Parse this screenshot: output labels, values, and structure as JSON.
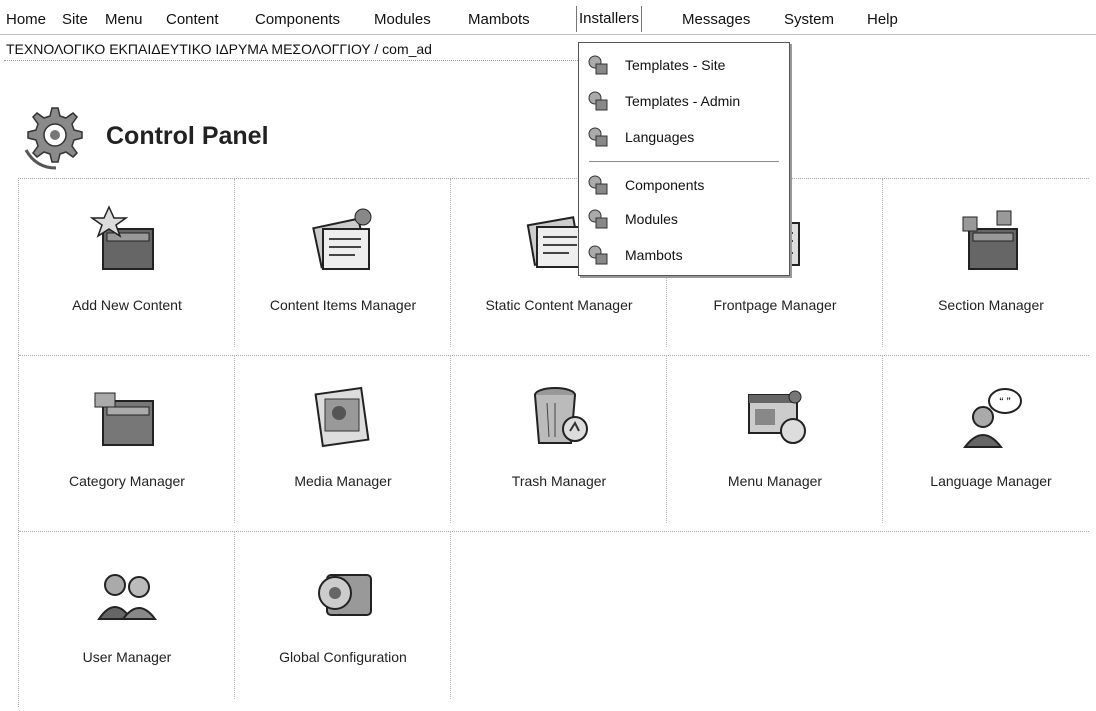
{
  "menu": {
    "items": [
      {
        "label": "Home",
        "active": false
      },
      {
        "label": "Site",
        "active": false
      },
      {
        "label": "Menu",
        "active": false
      },
      {
        "label": "Content",
        "active": false
      },
      {
        "label": "Components",
        "active": false
      },
      {
        "label": "Modules",
        "active": false
      },
      {
        "label": "Mambots",
        "active": false
      },
      {
        "label": "Installers",
        "active": true
      },
      {
        "label": "Messages",
        "active": false
      },
      {
        "label": "System",
        "active": false
      },
      {
        "label": "Help",
        "active": false
      }
    ]
  },
  "breadcrumb": "ΤΕΧΝΟΛΟΓΙΚΟ ΕΚΠΑΙΔΕΥΤΙΚΟ ΙΔΡΥΜΑ ΜΕΣΟΛΟΓΓΙΟΥ / com_ad",
  "page": {
    "title": "Control Panel",
    "title_icon": "gear-icon"
  },
  "dropdown": {
    "items": [
      {
        "label": "Templates - Site",
        "icon": "installer-icon"
      },
      {
        "label": "Templates - Admin",
        "icon": "installer-icon"
      },
      {
        "label": "Languages",
        "icon": "installer-icon"
      },
      {
        "label": "Components",
        "icon": "installer-icon"
      },
      {
        "label": "Modules",
        "icon": "installer-icon"
      },
      {
        "label": "Mambots",
        "icon": "installer-icon"
      }
    ]
  },
  "panel": {
    "items": [
      {
        "label": "Add New Content",
        "icon": "add-content-icon"
      },
      {
        "label": "Content Items Manager",
        "icon": "content-items-icon"
      },
      {
        "label": "Static Content Manager",
        "icon": "static-content-icon"
      },
      {
        "label": "Frontpage Manager",
        "icon": "frontpage-icon"
      },
      {
        "label": "Section Manager",
        "icon": "section-icon"
      },
      {
        "label": "Category Manager",
        "icon": "category-icon"
      },
      {
        "label": "Media Manager",
        "icon": "media-icon"
      },
      {
        "label": "Trash Manager",
        "icon": "trash-icon"
      },
      {
        "label": "Menu Manager",
        "icon": "menu-icon"
      },
      {
        "label": "Language Manager",
        "icon": "language-icon"
      },
      {
        "label": "User Manager",
        "icon": "users-icon"
      },
      {
        "label": "Global Configuration",
        "icon": "config-icon"
      }
    ]
  }
}
